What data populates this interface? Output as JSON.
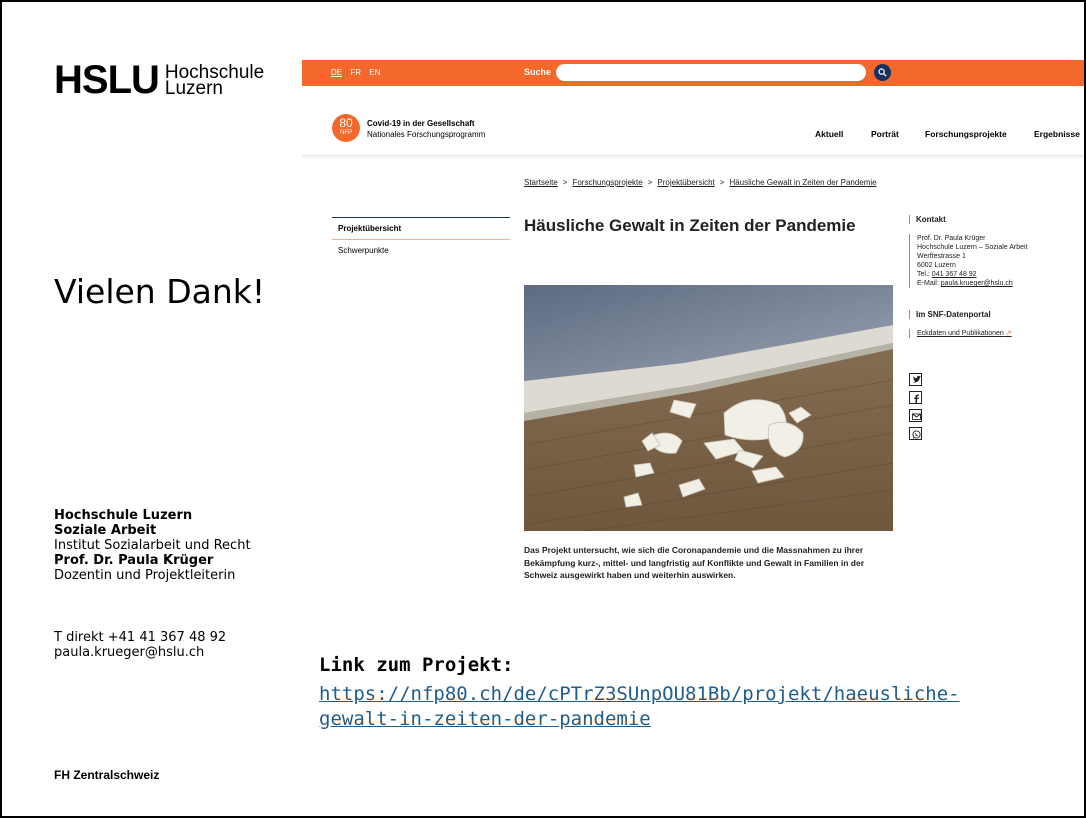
{
  "left": {
    "logo_mark": "HSLU",
    "logo_line1": "Hochschule",
    "logo_line2": "Luzern",
    "thanks": "Vielen Dank!",
    "org_line1": "Hochschule Luzern",
    "org_line2": "Soziale Arbeit",
    "institute": "Institut Sozialarbeit und Recht",
    "person": "Prof. Dr. Paula Krüger",
    "role": "Dozentin und Projektleiterin",
    "phone": "T direkt +41 41 367 48 92",
    "email": "paula.krueger@hslu.ch",
    "footer": "FH Zentralschweiz"
  },
  "website": {
    "langs": [
      "DE",
      "FR",
      "EN"
    ],
    "active_lang": "DE",
    "search_label": "Suche",
    "search_value": "",
    "badge_number": "80",
    "badge_text": "NFP",
    "program_title": "Covid-19 in der Gesellschaft",
    "program_subtitle": "Nationales Forschungsprogramm",
    "nav": [
      "Aktuell",
      "Porträt",
      "Forschungsprojekte",
      "Ergebnisse"
    ],
    "breadcrumb": [
      "Startseite",
      "Forschungsprojekte",
      "Projektübersicht",
      "Häusliche Gewalt in Zeiten der Pandemie"
    ],
    "breadcrumb_sep": ">",
    "leftnav": [
      "Projektübersicht",
      "Schwerpunkte"
    ],
    "page_title": "Häusliche Gewalt in Zeiten der Pandemie",
    "summary": "Das Projekt untersucht, wie sich die Coronapandemie und die Massnahmen zu ihrer Bekämpfung kurz-, mittel- und langfristig auf Konflikte und Gewalt in Familien in der Schweiz ausgewirkt haben und weiterhin auswirken.",
    "contact_heading": "Kontakt",
    "contact_lines": [
      "Prof. Dr. Paula Krüger",
      "Hochschule Luzern – Soziale Arbeit",
      "Werftestrasse 1",
      "6002 Luzern"
    ],
    "contact_tel_label": "Tel.: ",
    "contact_tel": "041 367 48 92",
    "contact_mail_label": "E-Mail: ",
    "contact_mail": "paula.krueger@hslu.ch",
    "portal_heading": "Im SNF-Datenportal",
    "portal_link": "Eckdaten und Publikationen",
    "social": [
      "twitter-icon",
      "facebook-icon",
      "mail-icon",
      "whatsapp-icon"
    ]
  },
  "link": {
    "title": "Link zum Projekt:",
    "url_line1": "https://nfp80.ch/de/cPTrZ3SUnpOU81Bb/projekt/haeusliche-",
    "url_line2": "gewalt-in-zeiten-der-pandemie"
  },
  "colors": {
    "orange": "#f4682b",
    "navy": "#17325f",
    "link": "#1f5c8e"
  }
}
